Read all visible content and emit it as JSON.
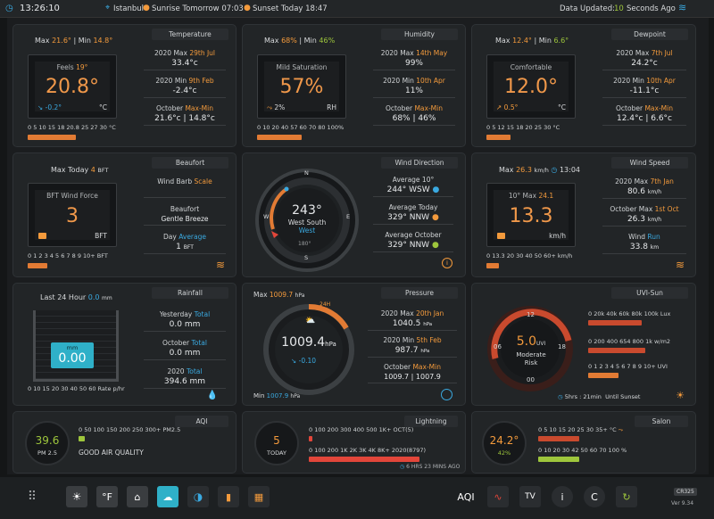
{
  "topbar": {
    "time": "13:26:10",
    "location": "Istanbul",
    "sunrise": "Sunrise Tomorrow 07:03",
    "sunset": "Sunset Today 18:47",
    "updated_prefix": "Data Updated:",
    "updated_value": "10",
    "updated_suffix": "Seconds Ago"
  },
  "temperature": {
    "title": "Temperature",
    "max_label": "Max",
    "max": "21.6°",
    "min_label": "Min",
    "min": "14.8°",
    "gauge_title": "Feels",
    "feels": "19°",
    "value": "20.8°",
    "trend": "-0.2°",
    "unit": "°C",
    "scale": "0 5 10 15 18 20.8 25 27 30 °C",
    "s1_label": "2020 Max",
    "s1_date": "29th Jul",
    "s1_val": "33.4°c",
    "s2_label": "2020 Min",
    "s2_date": "9th Feb",
    "s2_val": "-2.4°c",
    "s3_label": "October",
    "s3_hl": "Max-Min",
    "s3_val": "21.6°c | 14.8°c"
  },
  "humidity": {
    "title": "Humidity",
    "max_label": "Max",
    "max": "68%",
    "min_label": "Min",
    "min": "46%",
    "gauge_title": "Mild Saturation",
    "value": "57%",
    "trend": "2%",
    "unit": "RH",
    "scale": "0 10 20 40 57 60 70 80 100%",
    "s1_label": "2020 Max",
    "s1_date": "14th May",
    "s1_val": "99%",
    "s2_label": "2020 Min",
    "s2_date": "10th Apr",
    "s2_val": "11%",
    "s3_label": "October",
    "s3_hl": "Max-Min",
    "s3_val": "68% | 46%"
  },
  "dewpoint": {
    "title": "Dewpoint",
    "max_label": "Max",
    "max": "12.4°",
    "min_label": "Min",
    "min": "6.6°",
    "gauge_title": "Comfortable",
    "value": "12.0°",
    "trend": "0.5°",
    "unit": "°C",
    "scale": "0 5 12 15 18 20 25 30 °C",
    "s1_label": "2020 Max",
    "s1_date": "7th Jul",
    "s1_val": "24.2°c",
    "s2_label": "2020 Min",
    "s2_date": "10th Apr",
    "s2_val": "-11.1°c",
    "s3_label": "October",
    "s3_hl": "Max-Min",
    "s3_val": "12.4°c | 6.6°c"
  },
  "beaufort": {
    "title": "Beaufort",
    "max_label": "Max Today",
    "max": "4",
    "max_unit": "BFT",
    "gauge_title": "BFT Wind Force",
    "value": "3",
    "unit": "BFT",
    "scale": "0 1 2 3 4 5 6 7 8 9 10+ BFT",
    "barb_label": "Wind Barb",
    "barb_hl": "Scale",
    "b_label": "Beaufort",
    "b_val": "Gentle Breeze",
    "day_label": "Day",
    "day_hl": "Average",
    "day_val": "1",
    "day_unit": "BFT"
  },
  "winddir": {
    "title": "Wind Direction",
    "value": "243°",
    "dir1": "West South",
    "dir2": "West",
    "a1_label": "Average 10°",
    "a1_val": "244°",
    "a1_dir": "WSW",
    "a2_label": "Average Today",
    "a2_val": "329°",
    "a2_dir": "NNW",
    "a3_label": "Average October",
    "a3_val": "329°",
    "a3_dir": "NNW",
    "n": "N",
    "s": "S",
    "e": "E",
    "w": "W",
    "deg180": "180°"
  },
  "windspeed": {
    "title": "Wind Speed",
    "max_label": "Max",
    "max": "26.3",
    "max_unit": "km/h",
    "max_time": "13:04",
    "gauge_title": "10° Max",
    "gauge_max": "24.1",
    "value": "13.3",
    "unit": "km/h",
    "scale": "0 13.3 20 30 40 50 60+ km/h",
    "s1_label": "2020 Max",
    "s1_date": "7th Jan",
    "s1_val": "80.6",
    "s1_unit": "km/h",
    "s2_label": "October Max",
    "s2_date": "1st Oct",
    "s2_val": "26.3",
    "s2_unit": "km/h",
    "s3_label": "Wind",
    "s3_hl": "Run",
    "s3_val": "33.8",
    "s3_unit": "km"
  },
  "rainfall": {
    "title": "Rainfall",
    "last_label": "Last 24 Hour",
    "last_val": "0.0",
    "last_unit": "mm",
    "lcd_unit": "mm",
    "lcd_val": "0.00",
    "scale": "0 10 15 20 30 40 50 60 Rate p/hr",
    "s1_label": "Yesterday",
    "s1_hl": "Total",
    "s1_val": "0.0 mm",
    "s2_label": "October",
    "s2_hl": "Total",
    "s2_val": "0.0 mm",
    "s3_label": "2020",
    "s3_hl": "Total",
    "s3_val": "394.6 mm"
  },
  "pressure": {
    "title": "Pressure",
    "max_label": "Max",
    "max": "1009.7",
    "max_unit": "hPa",
    "min_label": "Min",
    "min": "1007.9",
    "min_unit": "hPa",
    "tag": "24H",
    "value": "1009.4",
    "unit": "hPa",
    "trend": "-0.10",
    "s1_label": "2020 Max",
    "s1_date": "20th Jan",
    "s1_val": "1040.5",
    "s2_label": "2020 Min",
    "s2_date": "5th Feb",
    "s2_val": "987.7",
    "s3_label": "October",
    "s3_hl": "Max-Min",
    "s3_val": "1009.7 | 1007.9",
    "hpa": "hPa"
  },
  "uvi": {
    "title": "UVI-Sun",
    "value": "5.0",
    "unit": "UVI",
    "level1": "Moderate",
    "level2": "Risk",
    "t12": "12",
    "t06": "06",
    "t18": "18",
    "t00": "00",
    "lux_scale": "0 20k 40k 60k 80k 100k Lux",
    "lux_hl": "80k",
    "wm_scale": "0 200 400 654 800 1k w/m2",
    "wm_hl": "654",
    "uv_scale": "0 1 2 3 4 5 6 7 8 9 10+ UVI",
    "sun_left": "5hrs : 21min",
    "sun_label": "Until Sunset"
  },
  "aqi": {
    "title": "AQI",
    "value": "39.6",
    "unit": "PM 2.5",
    "scale": "0 50 100 150 200 250 300+ PM2.5",
    "quality": "GOOD AIR QUALITY"
  },
  "lightning": {
    "title": "Lightning",
    "value": "5",
    "unit": "TODAY",
    "scale1": "0 100 200 300 400 500 1K+ OCT(5)",
    "scale2": "0 100 200 1K 2K 3K 4K 8K+ 2020(8797)",
    "ago": "6 HRS 23 MINS AGO"
  },
  "salon": {
    "title": "Salon",
    "value": "24.2°",
    "hum": "42%",
    "scale1": "0 5 10 15 20 25 30 35+ °C",
    "scale2": "0 10 20 30 42 50 60 70 100 %"
  },
  "dock": {
    "f": "°F",
    "aqi": "AQI",
    "tv": "TV",
    "info": "i",
    "c": "C",
    "version": "Ver 9.34",
    "brand": "CR325"
  },
  "colors": {
    "accent": "#f39a3c",
    "green": "#9ec63c",
    "blue": "#3aa9e0",
    "red": "#e2463a"
  }
}
